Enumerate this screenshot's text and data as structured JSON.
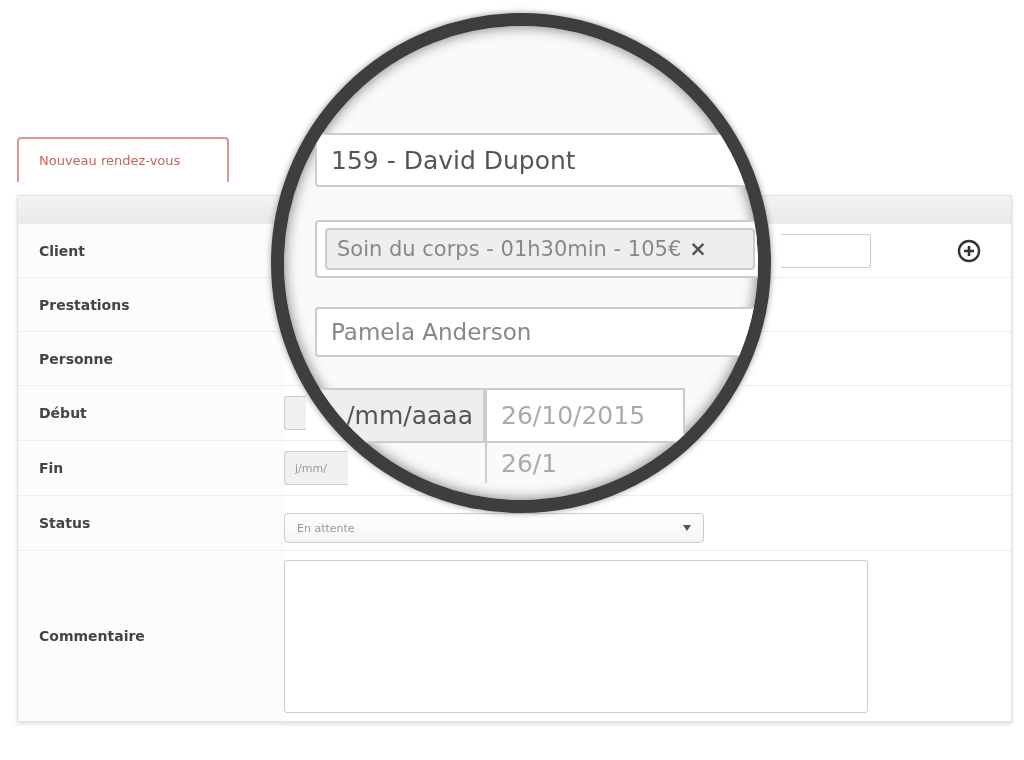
{
  "tab": {
    "label": "Nouveau rendez-vous",
    "selected": true
  },
  "form": {
    "rows": [
      {
        "label": "Client",
        "kind": "client"
      },
      {
        "label": "Prestations",
        "kind": "blank"
      },
      {
        "label": "Personne",
        "kind": "blank"
      },
      {
        "label": "Début",
        "kind": "date"
      },
      {
        "label": "Fin",
        "kind": "date",
        "placeholder": "j/mm/"
      },
      {
        "label": "Status",
        "kind": "select",
        "value": "En attente"
      },
      {
        "label": "Commentaire",
        "kind": "textarea"
      }
    ]
  },
  "magnifier": {
    "client": "159 - David Dupont",
    "service_tag": "Soin du corps - 01h30min - 105€",
    "tag_remove": "×",
    "person": "Pamela Anderson",
    "start_placeholder": "/mm/aaaa",
    "start_value": "26/10/2015",
    "end_value": "26/1"
  }
}
